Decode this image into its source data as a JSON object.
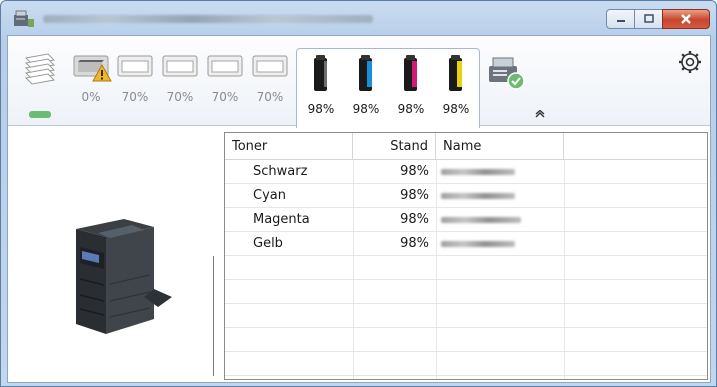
{
  "window": {
    "minimize_label": "–",
    "maximize_label": "▢",
    "close_label": "✕"
  },
  "trays": [
    {
      "id": "stack",
      "label": ""
    },
    {
      "id": "tray1",
      "label": "0%",
      "warning": true
    },
    {
      "id": "tray2",
      "label": "70%"
    },
    {
      "id": "tray3",
      "label": "70%"
    },
    {
      "id": "tray4",
      "label": "70%"
    },
    {
      "id": "tray5",
      "label": "70%"
    }
  ],
  "toners": [
    {
      "name": "Schwarz",
      "level": "98%",
      "color": "#1a1a1a"
    },
    {
      "name": "Cyan",
      "level": "98%",
      "color": "#1a8fd6"
    },
    {
      "name": "Magenta",
      "level": "98%",
      "color": "#d1197a"
    },
    {
      "name": "Gelb",
      "level": "98%",
      "color": "#e9d20b"
    }
  ],
  "icons": {
    "app": "printer-app-icon",
    "settings": "gear-icon",
    "collapse": "chevron-up-icon",
    "device_status": "device-ok-icon",
    "warning": "warning-icon"
  },
  "table": {
    "headers": {
      "toner": "Toner",
      "stand": "Stand",
      "name": "Name"
    },
    "rows": [
      {
        "toner": "Schwarz",
        "stand": "98%"
      },
      {
        "toner": "Cyan",
        "stand": "98%"
      },
      {
        "toner": "Magenta",
        "stand": "98%"
      },
      {
        "toner": "Gelb",
        "stand": "98%"
      }
    ]
  },
  "colors": {
    "status_ok": "#6dbb73",
    "warning": "#f0b72a"
  }
}
